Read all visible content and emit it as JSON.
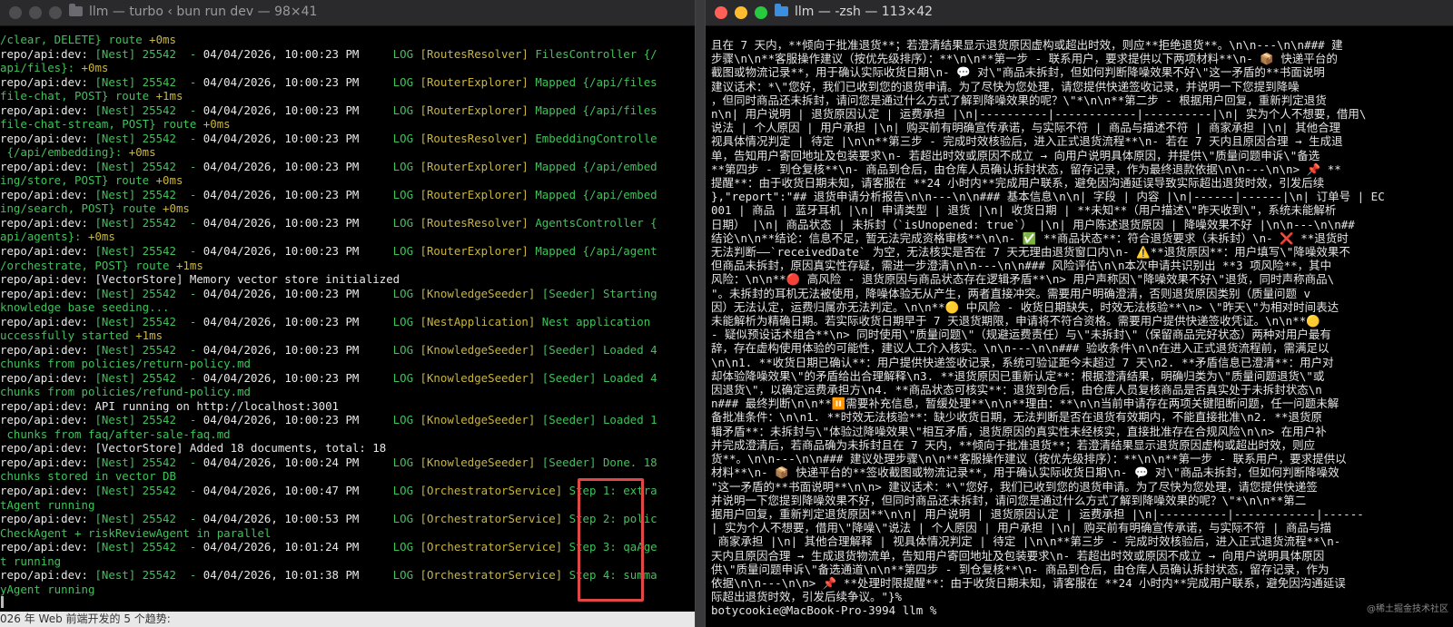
{
  "left_window": {
    "title": "llm — turbo ‹ bun run dev — 98×41",
    "lines": [
      [
        {
          "t": "/clear, DELETE} route ",
          "c": "c-green"
        },
        {
          "t": "+0ms",
          "c": "c-yellow"
        }
      ],
      [
        {
          "t": "repo/api:dev: ",
          "c": "c-white"
        },
        {
          "t": "[Nest] 25542  - ",
          "c": "c-green"
        },
        {
          "t": "04/04/2026, 10:00:23 PM",
          "c": "c-white"
        },
        {
          "t": "     LOG ",
          "c": "c-green"
        },
        {
          "t": "[RoutesResolver]",
          "c": "c-yellow"
        },
        {
          "t": " FilesController {/",
          "c": "c-green"
        }
      ],
      [
        {
          "t": "api/files}: ",
          "c": "c-green"
        },
        {
          "t": "+0ms",
          "c": "c-yellow"
        }
      ],
      [
        {
          "t": "repo/api:dev: ",
          "c": "c-white"
        },
        {
          "t": "[Nest] 25542  - ",
          "c": "c-green"
        },
        {
          "t": "04/04/2026, 10:00:23 PM",
          "c": "c-white"
        },
        {
          "t": "     LOG ",
          "c": "c-green"
        },
        {
          "t": "[RouterExplorer]",
          "c": "c-yellow"
        },
        {
          "t": " Mapped {/api/files",
          "c": "c-green"
        }
      ],
      [
        {
          "t": "file-chat, POST} route ",
          "c": "c-green"
        },
        {
          "t": "+1ms",
          "c": "c-yellow"
        }
      ],
      [
        {
          "t": "repo/api:dev: ",
          "c": "c-white"
        },
        {
          "t": "[Nest] 25542  - ",
          "c": "c-green"
        },
        {
          "t": "04/04/2026, 10:00:23 PM",
          "c": "c-white"
        },
        {
          "t": "     LOG ",
          "c": "c-green"
        },
        {
          "t": "[RouterExplorer]",
          "c": "c-yellow"
        },
        {
          "t": " Mapped {/api/files",
          "c": "c-green"
        }
      ],
      [
        {
          "t": "file-chat-stream, POST} route ",
          "c": "c-green"
        },
        {
          "t": "+0ms",
          "c": "c-yellow"
        }
      ],
      [
        {
          "t": "repo/api:dev: ",
          "c": "c-white"
        },
        {
          "t": "[Nest] 25542  - ",
          "c": "c-green"
        },
        {
          "t": "04/04/2026, 10:00:23 PM",
          "c": "c-white"
        },
        {
          "t": "     LOG ",
          "c": "c-green"
        },
        {
          "t": "[RoutesResolver]",
          "c": "c-yellow"
        },
        {
          "t": " EmbeddingControlle",
          "c": "c-green"
        }
      ],
      [
        {
          "t": " {/api/embedding}: ",
          "c": "c-green"
        },
        {
          "t": "+0ms",
          "c": "c-yellow"
        }
      ],
      [
        {
          "t": "repo/api:dev: ",
          "c": "c-white"
        },
        {
          "t": "[Nest] 25542  - ",
          "c": "c-green"
        },
        {
          "t": "04/04/2026, 10:00:23 PM",
          "c": "c-white"
        },
        {
          "t": "     LOG ",
          "c": "c-green"
        },
        {
          "t": "[RouterExplorer]",
          "c": "c-yellow"
        },
        {
          "t": " Mapped {/api/embed",
          "c": "c-green"
        }
      ],
      [
        {
          "t": "ing/store, POST} route ",
          "c": "c-green"
        },
        {
          "t": "+0ms",
          "c": "c-yellow"
        }
      ],
      [
        {
          "t": "repo/api:dev: ",
          "c": "c-white"
        },
        {
          "t": "[Nest] 25542  - ",
          "c": "c-green"
        },
        {
          "t": "04/04/2026, 10:00:23 PM",
          "c": "c-white"
        },
        {
          "t": "     LOG ",
          "c": "c-green"
        },
        {
          "t": "[RouterExplorer]",
          "c": "c-yellow"
        },
        {
          "t": " Mapped {/api/embed",
          "c": "c-green"
        }
      ],
      [
        {
          "t": "ing/search, POST} route ",
          "c": "c-green"
        },
        {
          "t": "+0ms",
          "c": "c-yellow"
        }
      ],
      [
        {
          "t": "repo/api:dev: ",
          "c": "c-white"
        },
        {
          "t": "[Nest] 25542  - ",
          "c": "c-green"
        },
        {
          "t": "04/04/2026, 10:00:23 PM",
          "c": "c-white"
        },
        {
          "t": "     LOG ",
          "c": "c-green"
        },
        {
          "t": "[RoutesResolver]",
          "c": "c-yellow"
        },
        {
          "t": " AgentsController {",
          "c": "c-green"
        }
      ],
      [
        {
          "t": "api/agents}: ",
          "c": "c-green"
        },
        {
          "t": "+0ms",
          "c": "c-yellow"
        }
      ],
      [
        {
          "t": "repo/api:dev: ",
          "c": "c-white"
        },
        {
          "t": "[Nest] 25542  - ",
          "c": "c-green"
        },
        {
          "t": "04/04/2026, 10:00:23 PM",
          "c": "c-white"
        },
        {
          "t": "     LOG ",
          "c": "c-green"
        },
        {
          "t": "[RouterExplorer]",
          "c": "c-yellow"
        },
        {
          "t": " Mapped {/api/agent",
          "c": "c-green"
        }
      ],
      [
        {
          "t": "/orchestrate, POST} route ",
          "c": "c-green"
        },
        {
          "t": "+1ms",
          "c": "c-yellow"
        }
      ],
      [
        {
          "t": "repo/api:dev: ",
          "c": "c-white"
        },
        {
          "t": "[VectorStore] Memory vector store initialized",
          "c": "c-white"
        }
      ],
      [
        {
          "t": "repo/api:dev: ",
          "c": "c-white"
        },
        {
          "t": "[Nest] 25542  - ",
          "c": "c-green"
        },
        {
          "t": "04/04/2026, 10:00:23 PM",
          "c": "c-white"
        },
        {
          "t": "     LOG ",
          "c": "c-green"
        },
        {
          "t": "[KnowledgeSeeder]",
          "c": "c-yellow"
        },
        {
          "t": " [Seeder] Starting",
          "c": "c-green"
        }
      ],
      [
        {
          "t": "knowledge base seeding...",
          "c": "c-green"
        }
      ],
      [
        {
          "t": "repo/api:dev: ",
          "c": "c-white"
        },
        {
          "t": "[Nest] 25542  - ",
          "c": "c-green"
        },
        {
          "t": "04/04/2026, 10:00:23 PM",
          "c": "c-white"
        },
        {
          "t": "     LOG ",
          "c": "c-green"
        },
        {
          "t": "[NestApplication]",
          "c": "c-yellow"
        },
        {
          "t": " Nest application",
          "c": "c-green"
        }
      ],
      [
        {
          "t": "uccessfully started ",
          "c": "c-green"
        },
        {
          "t": "+1ms",
          "c": "c-yellow"
        }
      ],
      [
        {
          "t": "repo/api:dev: ",
          "c": "c-white"
        },
        {
          "t": "[Nest] 25542  - ",
          "c": "c-green"
        },
        {
          "t": "04/04/2026, 10:00:23 PM",
          "c": "c-white"
        },
        {
          "t": "     LOG ",
          "c": "c-green"
        },
        {
          "t": "[KnowledgeSeeder]",
          "c": "c-yellow"
        },
        {
          "t": " [Seeder] Loaded 4",
          "c": "c-green"
        }
      ],
      [
        {
          "t": "chunks from policies/return-policy.md",
          "c": "c-green"
        }
      ],
      [
        {
          "t": "repo/api:dev: ",
          "c": "c-white"
        },
        {
          "t": "[Nest] 25542  - ",
          "c": "c-green"
        },
        {
          "t": "04/04/2026, 10:00:23 PM",
          "c": "c-white"
        },
        {
          "t": "     LOG ",
          "c": "c-green"
        },
        {
          "t": "[KnowledgeSeeder]",
          "c": "c-yellow"
        },
        {
          "t": " [Seeder] Loaded 4",
          "c": "c-green"
        }
      ],
      [
        {
          "t": "chunks from policies/refund-policy.md",
          "c": "c-green"
        }
      ],
      [
        {
          "t": "repo/api:dev: ",
          "c": "c-white"
        },
        {
          "t": "API running on http://localhost:3001",
          "c": "c-white"
        }
      ],
      [
        {
          "t": "repo/api:dev: ",
          "c": "c-white"
        },
        {
          "t": "[Nest] 25542  - ",
          "c": "c-green"
        },
        {
          "t": "04/04/2026, 10:00:23 PM",
          "c": "c-white"
        },
        {
          "t": "     LOG ",
          "c": "c-green"
        },
        {
          "t": "[KnowledgeSeeder]",
          "c": "c-yellow"
        },
        {
          "t": " [Seeder] Loaded 1",
          "c": "c-green"
        }
      ],
      [
        {
          "t": " chunks from faq/after-sale-faq.md",
          "c": "c-green"
        }
      ],
      [
        {
          "t": "repo/api:dev: ",
          "c": "c-white"
        },
        {
          "t": "[VectorStore] Added 18 documents, total: 18",
          "c": "c-white"
        }
      ],
      [
        {
          "t": "repo/api:dev: ",
          "c": "c-white"
        },
        {
          "t": "[Nest] 25542  - ",
          "c": "c-green"
        },
        {
          "t": "04/04/2026, 10:00:24 PM",
          "c": "c-white"
        },
        {
          "t": "     LOG ",
          "c": "c-green"
        },
        {
          "t": "[KnowledgeSeeder]",
          "c": "c-yellow"
        },
        {
          "t": " [Seeder] Done. 18",
          "c": "c-green"
        }
      ],
      [
        {
          "t": "chunks stored in vector DB",
          "c": "c-green"
        }
      ],
      [
        {
          "t": "repo/api:dev: ",
          "c": "c-white"
        },
        {
          "t": "[Nest] 25542  - ",
          "c": "c-green"
        },
        {
          "t": "04/04/2026, 10:00:47 PM",
          "c": "c-white"
        },
        {
          "t": "     LOG ",
          "c": "c-green"
        },
        {
          "t": "[OrchestratorService]",
          "c": "c-yellow"
        },
        {
          "t": " Step 1: extra",
          "c": "c-green"
        }
      ],
      [
        {
          "t": "tAgent running",
          "c": "c-green"
        }
      ],
      [
        {
          "t": "repo/api:dev: ",
          "c": "c-white"
        },
        {
          "t": "[Nest] 25542  - ",
          "c": "c-green"
        },
        {
          "t": "04/04/2026, 10:00:53 PM",
          "c": "c-white"
        },
        {
          "t": "     LOG ",
          "c": "c-green"
        },
        {
          "t": "[OrchestratorService]",
          "c": "c-yellow"
        },
        {
          "t": " Step 2: polic",
          "c": "c-green"
        }
      ],
      [
        {
          "t": "CheckAgent + riskReviewAgent in parallel",
          "c": "c-green"
        }
      ],
      [
        {
          "t": "repo/api:dev: ",
          "c": "c-white"
        },
        {
          "t": "[Nest] 25542  - ",
          "c": "c-green"
        },
        {
          "t": "04/04/2026, 10:01:24 PM",
          "c": "c-white"
        },
        {
          "t": "     LOG ",
          "c": "c-green"
        },
        {
          "t": "[OrchestratorService]",
          "c": "c-yellow"
        },
        {
          "t": " Step 3: qaAge",
          "c": "c-green"
        }
      ],
      [
        {
          "t": "t running",
          "c": "c-green"
        }
      ],
      [
        {
          "t": "repo/api:dev: ",
          "c": "c-white"
        },
        {
          "t": "[Nest] 25542  - ",
          "c": "c-green"
        },
        {
          "t": "04/04/2026, 10:01:38 PM",
          "c": "c-white"
        },
        {
          "t": "     LOG ",
          "c": "c-green"
        },
        {
          "t": "[OrchestratorService]",
          "c": "c-yellow"
        },
        {
          "t": " Step 4: summa",
          "c": "c-green"
        }
      ],
      [
        {
          "t": "yAgent running",
          "c": "c-green"
        }
      ]
    ],
    "bottom_text": "026 年 Web 前端开发的 5 个趋势:"
  },
  "right_window": {
    "title": "llm — -zsh — 113×42",
    "lines": [
      "且在 7 天内，**倾向于批准退货**；若澄清结果显示退货原因虚构或超出时效，则应**拒绝退货**。\\n\\n---\\n\\n### 建",
      "步骤\\n\\n**客服操作建议（按优先级排序）：**\\n\\n**第一步 - 联系用户，要求提供以下两项材料**\\n- 📦 快递平台的",
      "截图或物流记录**，用于确认实际收货日期\\n- 💬 对\\\"商品未拆封，但如何判断降噪效果不好\\\"这一矛盾的**书面说明",
      "建议话术：*\\\"您好，我们已收到您的退货申请。为了尽快为您处理，请您提供快递签收记录，并说明一下您提到降噪",
      "，但同时商品还未拆封，请问您是通过什么方式了解到降噪效果的呢？\\\"*\\n\\n**第二步 - 根据用户回复，重新判定退货",
      "n\\n| 用户说明 | 退货原因认定 | 运费承担 |\\n|----------|------------|----------|\\n| 实为个人不想要，借用\\",
      "说法 | 个人原因 | 用户承担 |\\n| 购买前有明确宣传承诺，与实际不符 | 商品与描述不符 | 商家承担 |\\n| 其他合理",
      "视具体情况判定 | 待定 |\\n\\n**第三步 - 完成时效核验后，进入正式退货流程**\\n- 若在 7 天内且原因合理 → 生成退",
      "单，告知用户寄回地址及包装要求\\n- 若超出时效或原因不成立 → 向用户说明具体原因，并提供\\\"质量问题申诉\\\"备选",
      "**第四步 - 到仓复核**\\n- 商品到仓后，由仓库人员确认拆封状态，留存记录，作为最终退款依据\\n\\n---\\n\\n> 📌 **",
      "提醒**：由于收货日期未知，请客服在 **24 小时内**完成用户联系，避免因沟通延误导致实际超出退货时效，引发后续",
      "},\"report\":\"## 退货申请分析报告\\n\\n---\\n\\n### 基本信息\\n\\n| 字段 | 内容 |\\n|------|------|\\n| 订单号 | EC",
      "001 | 商品 | 蓝牙耳机 |\\n| 申请类型 | 退货 |\\n| 收货日期 | **未知**（用户描述\\\"昨天收到\\\"，系统未能解析",
      "日期） |\\n| 商品状态 | 未拆封（`isUnopened: true`） |\\n| 用户陈述退货原因 | 降噪效果不好 |\\n\\n---\\n\\n##",
      "结论\\n\\n**结论：信息不足，暂无法完成资格审核**\\n\\n- ✅ **商品状态**：符合退货要求（未拆封）\\n- ❌ **退货时",
      "无法判断——`receivedDate` 为空，无法核实是否在 7 天无理由退货窗口内\\n- ⚠️**退货原因**：用户填写\\\"降噪效果不",
      "但商品未拆封，原因真实性存疑，需进一步澄清\\n\\n---\\n\\n### 风险评估\\n\\n本次申请共识别出 **3 项风险**，其中",
      "风险：\\n\\n**🔴 高风险 - 退货原因与商品状态存在逻辑矛盾**\\n> 用户声称因\\\"降噪效果不好\\\"退货，同时声称商品\\",
      "\"。未拆封的耳机无法被使用，降噪体验无从产生，两者直接冲突。需要用户明确澄清，否则退货原因类别（质量问题 v",
      "因）无法认定，运费归属亦无法判定。\\n\\n**🟡 中风险 - 收货日期缺失，时效无法核验**\\n> \\\"昨天\\\"为相对时间表达",
      "未能解析为精确日期。若实际收货日期早于 7 天退货期限，申请将不符合资格。需要用户提供快递签收凭证。\\n\\n**🟡",
      "- 疑似预设话术组合**\\n> 同时使用\\\"质量问题\\\"（规避运费责任）与\\\"未拆封\\\"（保留商品完好状态）两种对用户最有",
      "辞，存在虚构使用体验的可能性，建议人工介入核实。\\n\\n---\\n\\n### 验收条件\\n\\n在进入正式退货流程前，需满足以",
      "\\n\\n1. **收货日期已确认**：用户提供快递签收记录，系统可验证距今未超过 7 天\\n2. **矛盾信息已澄清**：用户对",
      "却体验降噪效果\\\"的矛盾给出合理解释\\n3. **退货原因已重新认定**：根据澄清结果，明确归类为\\\"质量问题退货\\\"或",
      "因退货\\\"，以确定运费承担方\\n4. **商品状态可核实**：退货到仓后，由仓库人员复核商品是否真实处于未拆封状态\\n",
      "n### 最终判断\\n\\n**⏸️需要补充信息，暂缓处理**\\n\\n**理由：**\\n\\n当前申请存在两项关键阻断问题，任一问题未解",
      "备批准条件：\\n\\n1. **时效无法核验**：缺少收货日期，无法判断是否在退货有效期内，不能直接批准\\n2. **退货原",
      "辑矛盾**：未拆封与\\\"体验过降噪效果\\\"相互矛盾，退货原因的真实性未经核实，直接批准存在合规风险\\n\\n> 在用户补",
      "并完成澄清后，若商品确为未拆封且在 7 天内，**倾向于批准退货**；若澄清结果显示退货原因虚构或超出时效，则应",
      "货**。\\n\\n---\\n\\n### 建议处理步骤\\n\\n**客服操作建议（按优先级排序）：**\\n\\n**第一步 - 联系用户，要求提供以",
      "材料**\\n- 📦 快递平台的**签收截图或物流记录**，用于确认实际收货日期\\n- 💬 对\\\"商品未拆封，但如何判断降噪效",
      "\"这一矛盾的**书面说明**\\n\\n> 建议话术：*\\\"您好，我们已收到您的退货申请。为了尽快为您处理，请您提供快递签",
      "并说明一下您提到降噪效果不好，但同时商品还未拆封，请问您是通过什么方式了解到降噪效果的呢？\\\"*\\n\\n**第二",
      "据用户回复，重新判定退货原因**\\n\\n| 用户说明 | 退货原因认定 | 运费承担 |\\n|----------|------------|------",
      "| 实为个人不想要，借用\\\"降噪\\\"说法 | 个人原因 | 用户承担 |\\n| 购买前有明确宣传承诺，与实际不符 | 商品与描",
      " 商家承担 |\\n| 其他合理解释 | 视具体情况判定 | 待定 |\\n\\n**第三步 - 完成时效核验后，进入正式退货流程**\\n-",
      "天内且原因合理 → 生成退货物流单，告知用户寄回地址及包装要求\\n- 若超出时效或原因不成立 → 向用户说明具体原因",
      "供\\\"质量问题申诉\\\"备选通道\\n\\n**第四步 - 到仓复核**\\n- 商品到仓后，由仓库人员确认拆封状态，留存记录，作为",
      "依据\\n\\n---\\n\\n> 📌 **处理时限提醒**：由于收货日期未知，请客服在 **24 小时内**完成用户联系，避免因沟通延误",
      "际超出退货时效，引发后续争议。\"}%",
      "botycookie@MacBook-Pro-3994 llm % "
    ],
    "watermark": "@稀土掘金技术社区"
  },
  "colors": {
    "accent_highlight": "#e04848",
    "folder": "#3b8fe0",
    "folder_dim": "#6a6a70"
  }
}
